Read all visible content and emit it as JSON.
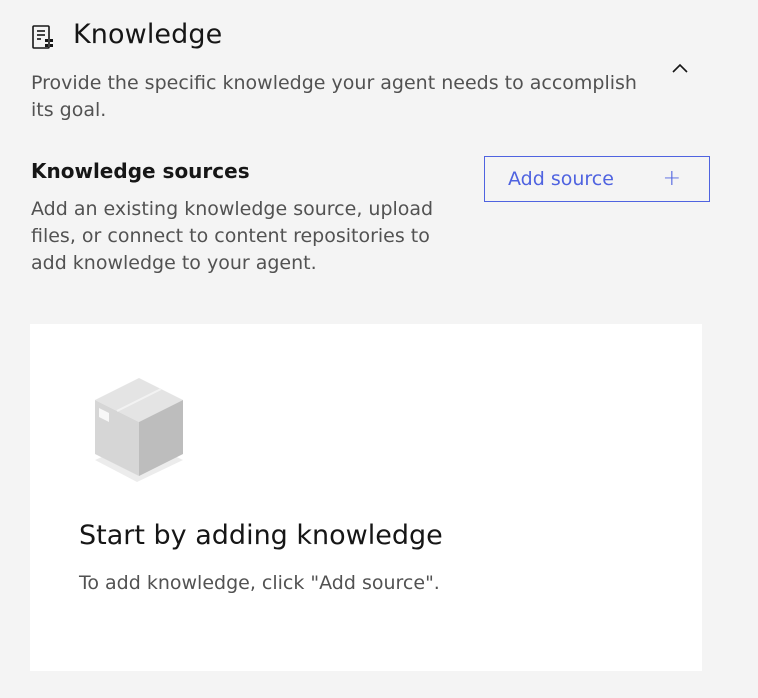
{
  "section": {
    "icon": "catalog-list-icon",
    "title": "Knowledge",
    "collapse_icon": "chevron-up-icon",
    "description": "Provide the specific knowledge your agent needs to accomplish its goal."
  },
  "sources": {
    "title": "Knowledge sources",
    "description": "Add an existing knowledge source, upload files, or connect to content repositories to add knowledge to your agent.",
    "add_button_label": "Add source",
    "add_button_icon": "plus-icon"
  },
  "empty_state": {
    "illustration": "box-icon",
    "title": "Start by adding knowledge",
    "description": "To add knowledge, click \"Add source\"."
  },
  "colors": {
    "page_background": "#f4f4f4",
    "card_background": "#ffffff",
    "accent": "#4f63e0",
    "text_primary": "#161616",
    "text_secondary": "#525252"
  }
}
